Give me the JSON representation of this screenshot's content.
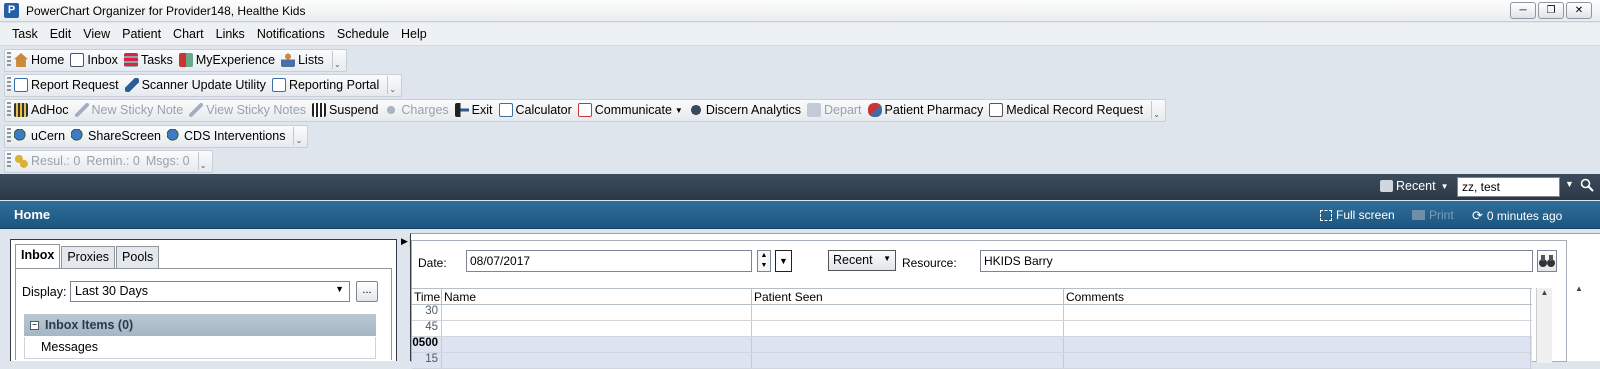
{
  "window": {
    "title": "PowerChart Organizer for Provider148, Healthe Kids",
    "app_icon_letter": "P"
  },
  "menu": [
    "Task",
    "Edit",
    "View",
    "Patient",
    "Chart",
    "Links",
    "Notifications",
    "Schedule",
    "Help"
  ],
  "toolbar1": {
    "home": "Home",
    "inbox": "Inbox",
    "tasks": "Tasks",
    "myexperience": "MyExperience",
    "lists": "Lists"
  },
  "toolbar2": {
    "report_request": "Report Request",
    "scanner_update": "Scanner Update Utility",
    "reporting_portal": "Reporting Portal"
  },
  "toolbar3": {
    "adhoc": "AdHoc",
    "new_sticky": "New Sticky Note",
    "view_sticky": "View Sticky Notes",
    "suspend": "Suspend",
    "charges": "Charges",
    "exit": "Exit",
    "calculator": "Calculator",
    "communicate": "Communicate",
    "discern": "Discern Analytics",
    "depart": "Depart",
    "pharmacy": "Patient Pharmacy",
    "mrr": "Medical Record Request"
  },
  "toolbar4": {
    "ucern": "uCern",
    "sharescreen": "ShareScreen",
    "cds": "CDS Interventions"
  },
  "toolbar5": {
    "results": "Resul.: 0",
    "reminders": "Remin.: 0",
    "messages": "Msgs: 0"
  },
  "searchbar": {
    "recent_label": "Recent",
    "patient_search": "zz, test"
  },
  "home": {
    "title": "Home",
    "full_screen": "Full screen",
    "print": "Print",
    "refresh": "0 minutes ago"
  },
  "inbox_panel": {
    "tabs": [
      "Inbox",
      "Proxies",
      "Pools"
    ],
    "display_label": "Display:",
    "display_value": "Last 30 Days",
    "ellipsis": "...",
    "inbox_items": "Inbox Items (0)",
    "messages": "Messages"
  },
  "schedule": {
    "date_label": "Date:",
    "date_value": "08/07/2017",
    "recent_select": "Recent",
    "resource_label": "Resource:",
    "resource_value": "HKIDS Barry",
    "columns": [
      "Time",
      "Name",
      "Patient Seen",
      "Comments"
    ],
    "rows": [
      {
        "time": "30",
        "hour": false,
        "shaded": false
      },
      {
        "time": "45",
        "hour": false,
        "shaded": false
      },
      {
        "time": "0500",
        "hour": true,
        "shaded": true
      },
      {
        "time": "15",
        "hour": false,
        "shaded": true
      }
    ]
  },
  "colors": {
    "dark_bar": "#2f3d4c",
    "home_bar": "#215d88",
    "shaded_row": "#dde3f0"
  }
}
